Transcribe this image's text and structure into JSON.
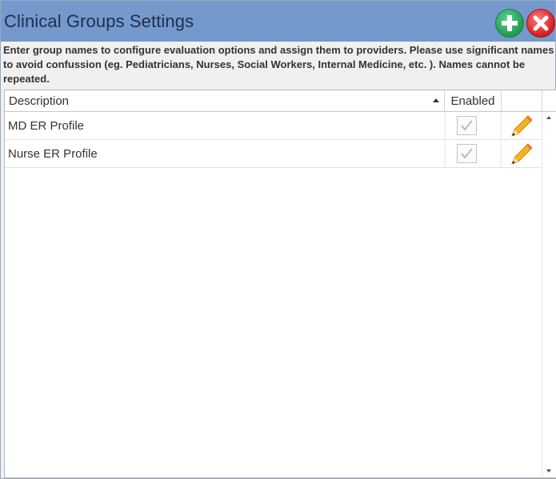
{
  "window": {
    "title": "Clinical Groups Settings",
    "add_icon": "plus-icon",
    "close_icon": "close-icon"
  },
  "instructions": "Enter group names to configure evaluation options and assign them to providers. Please use significant names to avoid confussion (eg. Pediatricians, Nurses, Social Workers, Internal Medicine, etc. ). Names cannot be repeated.",
  "grid": {
    "columns": {
      "description": "Description",
      "enabled": "Enabled",
      "edit": ""
    },
    "sort": {
      "column": "description",
      "direction": "ascending"
    },
    "rows": [
      {
        "description": "MD ER Profile",
        "enabled": true,
        "edit_icon": "pencil-icon"
      },
      {
        "description": "Nurse ER Profile",
        "enabled": true,
        "edit_icon": "pencil-icon"
      }
    ]
  },
  "colors": {
    "titlebar": "#7499cc",
    "add_button": "#2aa55f",
    "close_button": "#e0262b"
  }
}
